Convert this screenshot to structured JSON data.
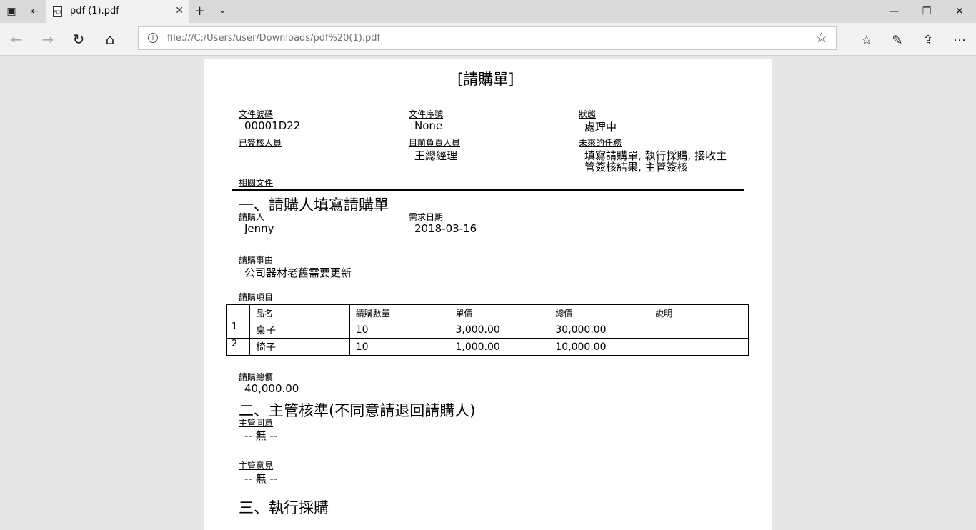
{
  "browser": {
    "tab_title": "pdf (1).pdf",
    "favicon_text": "PDF",
    "url": "file:///C:/Users/user/Downloads/pdf%20(1).pdf"
  },
  "doc": {
    "title": "[請購單]",
    "meta": {
      "doc_no_label": "文件號碼",
      "doc_no": "00001D22",
      "doc_seq_label": "文件序號",
      "doc_seq": "None",
      "status_label": "狀態",
      "status": "處理中",
      "signed_label": "已簽核人員",
      "current_label": "目前負責人員",
      "current": "王總經理",
      "future_label": "未來的任務",
      "future_line1": "填寫請購單, 執行採購, 接收主",
      "future_line2": "管簽核結果, 主管簽核",
      "related_label": "相關文件"
    },
    "section1": {
      "heading": "一、請購人填寫請購單",
      "requester_label": "請購人",
      "requester": "Jenny",
      "date_label": "需求日期",
      "date": "2018-03-16",
      "reason_label": "請購事由",
      "reason": "公司器材老舊需要更新",
      "items_label": "請購項目",
      "columns": [
        "",
        "品名",
        "請購數量",
        "單價",
        "總價",
        "說明"
      ],
      "rows": [
        [
          "1",
          "桌子",
          "10",
          "3,000.00",
          "30,000.00",
          ""
        ],
        [
          "2",
          "椅子",
          "10",
          "1,000.00",
          "10,000.00",
          ""
        ]
      ],
      "total_label": "請購總價",
      "total": "40,000.00"
    },
    "section2": {
      "heading": "二、主管核準(不同意請退回請購人)",
      "agree_label": "主管同意",
      "agree": "-- 無 --",
      "opinion_label": "主管意見",
      "opinion": "-- 無 --"
    },
    "section3": {
      "heading": "三、執行採購"
    }
  }
}
